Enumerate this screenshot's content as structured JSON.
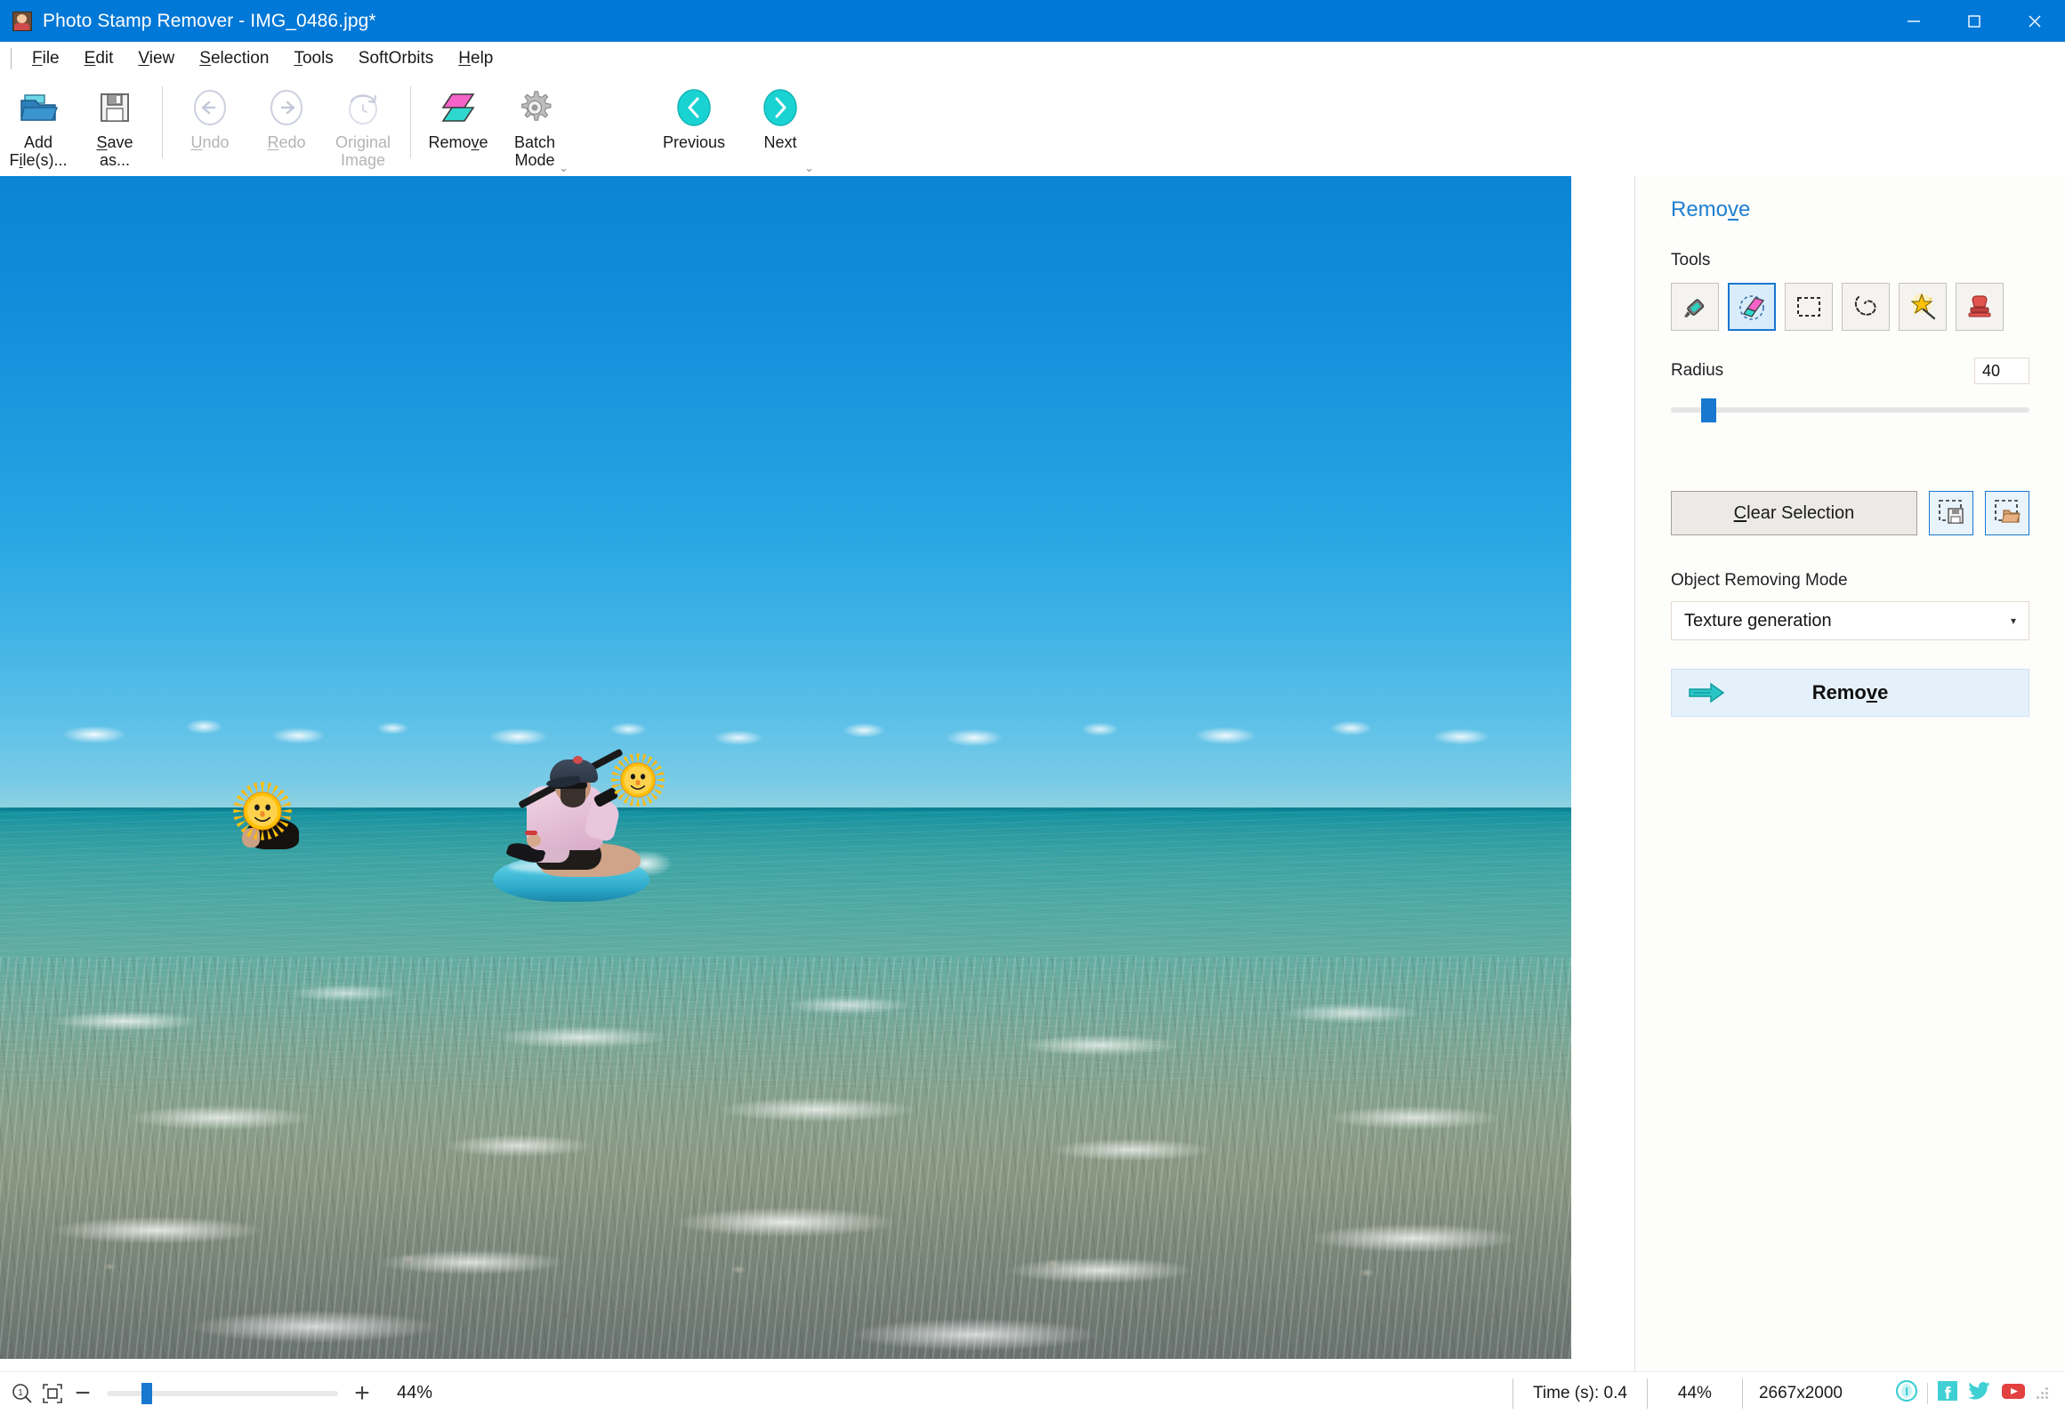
{
  "window": {
    "app_name": "Photo Stamp Remover",
    "title": "Photo Stamp Remover - IMG_0486.jpg*",
    "icon": "app-photo-icon",
    "minimize": "minimize-icon",
    "maximize": "maximize-icon",
    "close": "close-icon",
    "titlebar_color": "#0078d7"
  },
  "menubar": {
    "items": [
      {
        "label": "File",
        "accel": "F"
      },
      {
        "label": "Edit",
        "accel": "E"
      },
      {
        "label": "View",
        "accel": "V"
      },
      {
        "label": "Selection",
        "accel": "S"
      },
      {
        "label": "Tools",
        "accel": "T"
      },
      {
        "label": "SoftOrbits",
        "accel": ""
      },
      {
        "label": "Help",
        "accel": "H"
      }
    ]
  },
  "ribbon": {
    "groups": [
      {
        "buttons": [
          {
            "name": "add-files",
            "line1": "Add",
            "line2": "File(s)...",
            "icon": "open-folder-icon",
            "enabled": true,
            "accel": ""
          },
          {
            "name": "save-as",
            "line1": "Save",
            "line2": "as...",
            "icon": "floppy-disk-icon",
            "enabled": true,
            "accel": "S"
          }
        ]
      },
      {
        "buttons": [
          {
            "name": "undo",
            "line1": "Undo",
            "line2": "",
            "icon": "undo-arrow-icon",
            "enabled": false,
            "accel": "U"
          },
          {
            "name": "redo",
            "line1": "Redo",
            "line2": "",
            "icon": "redo-arrow-icon",
            "enabled": false,
            "accel": "R"
          },
          {
            "name": "original-image",
            "line1": "Original",
            "line2": "Image",
            "icon": "revert-clock-icon",
            "enabled": false,
            "accel": ""
          }
        ]
      },
      {
        "buttons": [
          {
            "name": "remove",
            "line1": "Remove",
            "line2": "",
            "icon": "parallelogram-remove-icon",
            "enabled": true,
            "accel": "v"
          },
          {
            "name": "batch-mode",
            "line1": "Batch",
            "line2": "Mode",
            "icon": "gear-icon",
            "enabled": true,
            "accel": ""
          }
        ],
        "expander": "group-expander-icon"
      },
      {
        "buttons": [
          {
            "name": "previous",
            "line1": "Previous",
            "line2": "",
            "icon": "chevron-left-circle-icon",
            "enabled": true,
            "accel": ""
          },
          {
            "name": "next",
            "line1": "Next",
            "line2": "",
            "icon": "chevron-right-circle-icon",
            "enabled": true,
            "accel": ""
          }
        ],
        "expander": "group-expander-icon"
      }
    ]
  },
  "canvas": {
    "photo_description": "Beach photo: paddleboarder and swimmer in turquoise sea under blue sky",
    "stickers": [
      {
        "name": "sun-smiley-sticker",
        "label": "sun-smiley-icon"
      },
      {
        "name": "sun-smiley-sticker",
        "label": "sun-smiley-icon"
      }
    ]
  },
  "panel": {
    "title": "Remove",
    "title_accel": "v",
    "tools_label": "Tools",
    "tools": [
      {
        "name": "marker-tool",
        "icon": "marker-pen-icon",
        "selected": false
      },
      {
        "name": "eraser-tool",
        "icon": "eraser-icon",
        "selected": true
      },
      {
        "name": "rectangle-select-tool",
        "icon": "rectangle-select-icon",
        "selected": false
      },
      {
        "name": "lasso-tool",
        "icon": "lasso-icon",
        "selected": false
      },
      {
        "name": "magic-wand-tool",
        "icon": "magic-wand-icon",
        "selected": false
      },
      {
        "name": "stamp-tool",
        "icon": "stamp-icon",
        "selected": false
      }
    ],
    "radius_label": "Radius",
    "radius_value": "40",
    "radius_slider_percent": 9,
    "clear_selection_label": "Clear Selection",
    "clear_selection_accel": "C",
    "save_selection_icon": "save-selection-icon",
    "load_selection_icon": "load-selection-icon",
    "mode_label": "Object Removing Mode",
    "mode_value": "Texture generation",
    "mode_caret": "chevron-down-icon",
    "remove_button_label": "Remove",
    "remove_button_accel": "v",
    "remove_button_icon": "arrow-right-icon",
    "accent_color": "#1f7fd0"
  },
  "statusbar": {
    "zoom_icon": "zoom-100-icon",
    "fit_icon": "fit-to-window-icon",
    "zoom_out": "minus-icon",
    "zoom_in": "plus-icon",
    "zoom_percent_left": "44%",
    "zoom_slider_percent": 15,
    "time_label": "Time (s): 0.4",
    "zoom_percent_right": "44%",
    "image_size": "2667x2000",
    "social": [
      {
        "name": "info-icon",
        "color": "#3fd0d4"
      },
      {
        "name": "facebook-icon",
        "color": "#3fd0d4"
      },
      {
        "name": "twitter-icon",
        "color": "#3fd0d4"
      },
      {
        "name": "youtube-icon",
        "color": "#e34040"
      }
    ],
    "resize_grip": "resize-grip-icon"
  }
}
